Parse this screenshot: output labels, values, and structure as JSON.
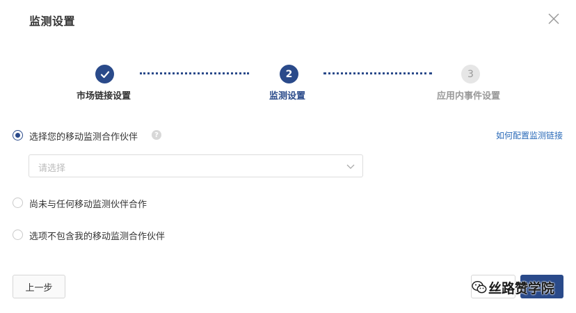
{
  "dialog": {
    "title": "监测设置"
  },
  "stepper": {
    "steps": [
      {
        "number": "",
        "label": "市场链接设置",
        "state": "done"
      },
      {
        "number": "2",
        "label": "监测设置",
        "state": "active"
      },
      {
        "number": "3",
        "label": "应用内事件设置",
        "state": "pending"
      }
    ]
  },
  "options": [
    {
      "label": "选择您的移动监测合作伙伴",
      "checked": true
    },
    {
      "label": "尚未与任何移动监测伙伴合作",
      "checked": false
    },
    {
      "label": "选项不包含我的移动监测合作伙伴",
      "checked": false
    }
  ],
  "help_icon": "?",
  "config_link": "如何配置监测链接",
  "partner_select": {
    "placeholder": "请选择",
    "icon": "chevron-down-icon"
  },
  "footer": {
    "prev_label": "上一步",
    "watermark": "丝路赞学院"
  },
  "colors": {
    "accent": "#2a4a8a",
    "link": "#2a6ab8",
    "pending": "#e6e6e6"
  }
}
